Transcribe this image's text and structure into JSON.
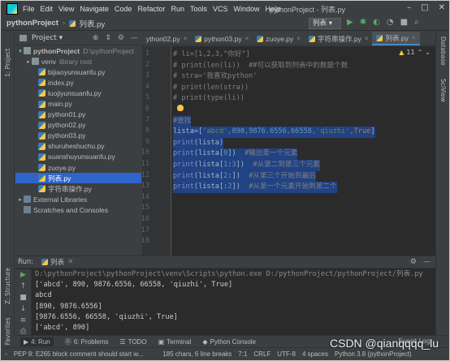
{
  "window": {
    "menus": [
      "File",
      "Edit",
      "View",
      "Navigate",
      "Code",
      "Refactor",
      "Run",
      "Tools",
      "VCS",
      "Window",
      "Help"
    ],
    "title": "pythonProject - 列表.py",
    "controls": [
      "–",
      "□",
      "✕"
    ]
  },
  "navbar": {
    "project": "pythonProject",
    "file": "列表.py",
    "run_config": "列表 ▾"
  },
  "left_strip": {
    "project_label": "1: Project",
    "structure_label": "Z: Structure",
    "favorites_label": "2: Favorites"
  },
  "right_strip": {
    "database_label": "Database",
    "sciview_label": "SciView"
  },
  "project_panel": {
    "title": "Project ▾",
    "items": [
      {
        "label": "pythonProject",
        "extra": "D:\\pythonProject",
        "kind": "folder",
        "arrow": "▾"
      },
      {
        "label": "venv",
        "extra": "library root",
        "kind": "folder",
        "arrow": "▸"
      },
      {
        "label": "bijiaoyunsuanfu.py",
        "kind": "py"
      },
      {
        "label": "index.py",
        "kind": "py"
      },
      {
        "label": "luojiyunsuanfu.py",
        "kind": "py"
      },
      {
        "label": "main.py",
        "kind": "py"
      },
      {
        "label": "python01.py",
        "kind": "py"
      },
      {
        "label": "python02.py",
        "kind": "py"
      },
      {
        "label": "python03.py",
        "kind": "py"
      },
      {
        "label": "shuruheshuchu.py",
        "kind": "py"
      },
      {
        "label": "suanshuyunsuanfu.py",
        "kind": "py"
      },
      {
        "label": "zuoye.py",
        "kind": "py"
      },
      {
        "label": "列表.py",
        "kind": "py"
      },
      {
        "label": "字符串操作.py",
        "kind": "py"
      },
      {
        "label": "External Libraries",
        "kind": "lib",
        "arrow": "▸"
      },
      {
        "label": "Scratches and Consoles",
        "kind": "scratch"
      }
    ]
  },
  "tabs": [
    {
      "label": "ython02.py",
      "active": false
    },
    {
      "label": "python03.py",
      "active": false
    },
    {
      "label": "zuoye.py",
      "active": false
    },
    {
      "label": "字符串操作.py",
      "active": false
    },
    {
      "label": "列表.py",
      "active": true
    }
  ],
  "editor": {
    "inspection": {
      "warnings": "11",
      "up": "⌃",
      "down": "⌄"
    },
    "line_numbers": [
      "1",
      "2",
      "3",
      "4",
      "5",
      "6",
      "7",
      "8",
      "9",
      "10",
      "11",
      "12",
      "13",
      "14",
      "15",
      "16",
      "17",
      "18"
    ],
    "lines": [
      "# li=[1,2,3,\"你好\"]",
      "# print(len(li))  ##可以获取到列表中的数据个数",
      "# stra='我喜欢python'",
      "# print(len(stra))",
      "# print(type(li))",
      "",
      "#查找",
      "lista=['abcd',890,9876.6556,66558,'qiuzhi',True]",
      "print(lista)",
      "print(lista[0])  #输出第一个元素",
      "print(lista[1:3])  #从第二到第三个元素",
      "print(lista[2:])  #从第三个开始到最后",
      "print(lista[:2])  #从第一个元素开始到第二个"
    ]
  },
  "run_panel": {
    "label": "Run:",
    "tab": "列表",
    "output": [
      "D:\\pythonProject\\pythonProject\\venv\\Scripts\\python.exe D:/pythonProject/pythonProject/列表.py",
      "['abcd', 890, 9876.6556, 66558, 'qiuzhi', True]",
      "abcd",
      "[890, 9876.6556]",
      "[9876.6556, 66558, 'qiuzhi', True]",
      "['abcd', 890]"
    ]
  },
  "bottom_tabs": [
    {
      "label": "4: Run",
      "icon": "▶"
    },
    {
      "label": "6: Problems",
      "icon": "⓪"
    },
    {
      "label": "TODO",
      "icon": "☰"
    },
    {
      "label": "Terminal",
      "icon": "▣"
    },
    {
      "label": "Python Console",
      "icon": "◆"
    }
  ],
  "event_log": "Event Log",
  "statusbar": {
    "message": "PEP 8: E265 block comment should start w...",
    "chars": "185 chars, 6 line breaks",
    "position": "7:1",
    "line_sep": "CRLF",
    "encoding": "UTF-8",
    "indent": "4 spaces",
    "interpreter": "Python 3.8 (pythonProject)"
  },
  "watermark": "CSDN @qianqqqq_lu",
  "colors": {
    "selection": "#214283",
    "accent": "#2f65ca",
    "bg": "#2b2b2b"
  }
}
